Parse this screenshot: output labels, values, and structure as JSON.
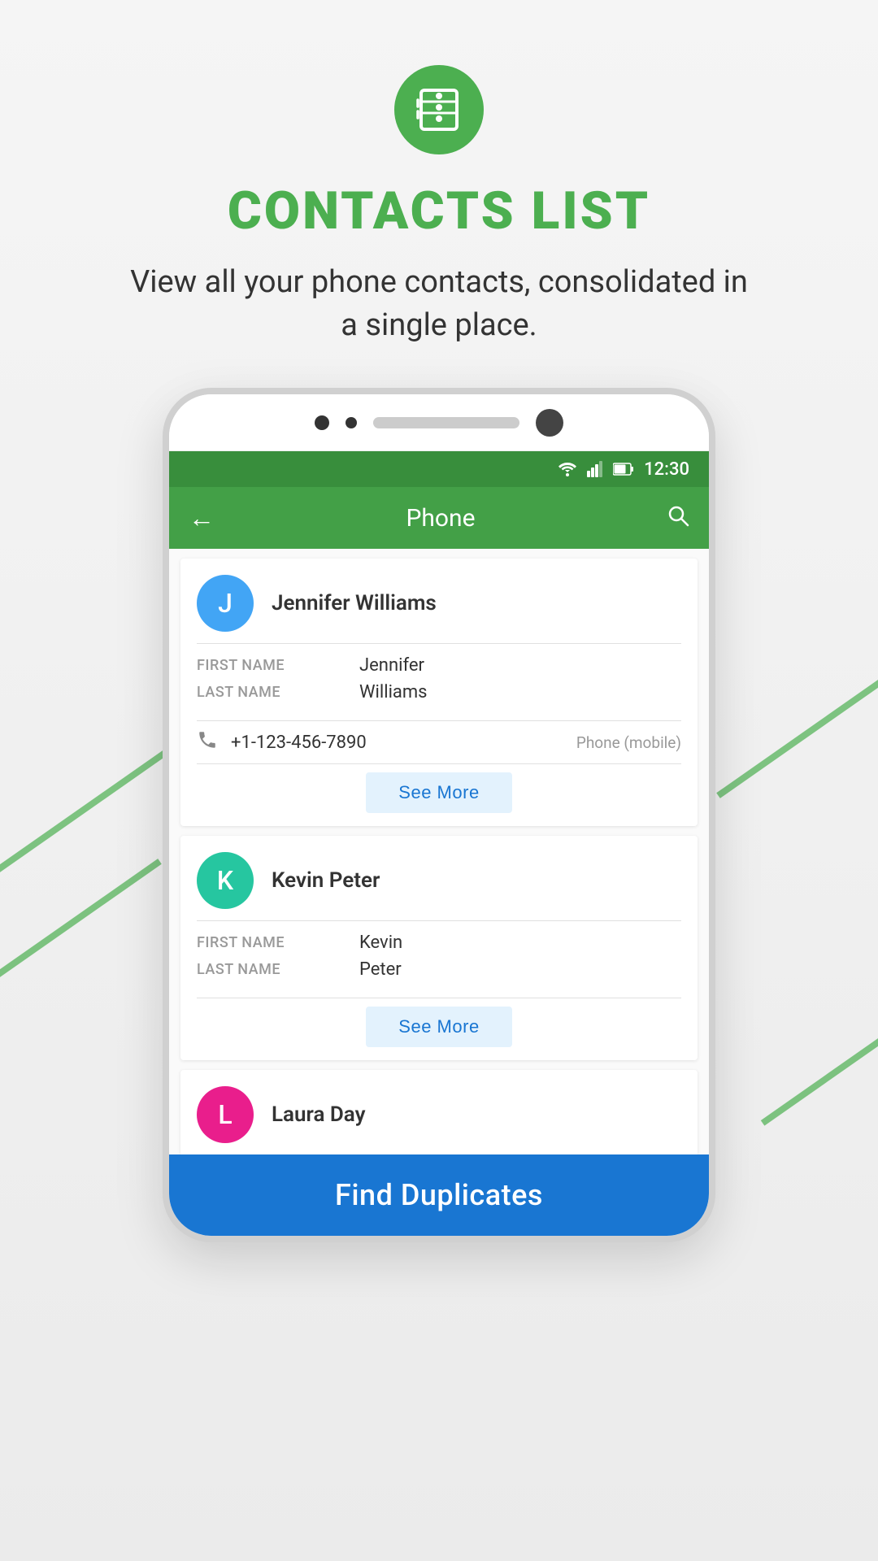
{
  "page": {
    "background": "#f0f0f0"
  },
  "header": {
    "icon_label": "contacts-book-icon",
    "title": "CONTACTS LIST",
    "subtitle": "View all your phone contacts, consolidated in a single place."
  },
  "phone_mockup": {
    "status_bar": {
      "time": "12:30"
    },
    "toolbar": {
      "back_label": "←",
      "title": "Phone",
      "search_label": "🔍"
    },
    "contacts": [
      {
        "id": "jennifer-williams",
        "name": "Jennifer Williams",
        "avatar_letter": "J",
        "avatar_color": "avatar-blue",
        "first_name_label": "FIRST NAME",
        "first_name": "Jennifer",
        "last_name_label": "LAST NAME",
        "last_name": "Williams",
        "phone": "+1-123-456-7890",
        "phone_type": "Phone (mobile)",
        "see_more_label": "See More"
      },
      {
        "id": "kevin-peter",
        "name": "Kevin Peter",
        "avatar_letter": "K",
        "avatar_color": "avatar-green",
        "first_name_label": "FIRST NAME",
        "first_name": "Kevin",
        "last_name_label": "LAST NAME",
        "last_name": "Peter",
        "see_more_label": "See More"
      },
      {
        "id": "laura-day",
        "name": "Laura Day",
        "avatar_letter": "L",
        "avatar_color": "avatar-pink",
        "partial": true
      }
    ],
    "find_duplicates": {
      "label": "Find Duplicates",
      "bg_color": "#1976d2"
    }
  }
}
